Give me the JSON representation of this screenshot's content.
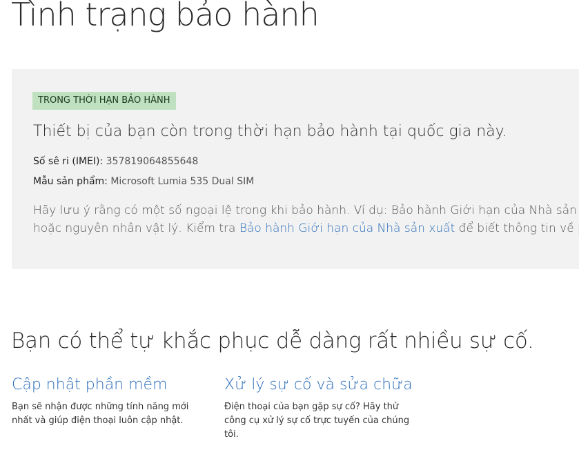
{
  "page": {
    "title": "Tình trạng bảo hành"
  },
  "status": {
    "badge": "TRONG THỜI HẠN BẢO HÀNH",
    "message": "Thiết bị của bạn còn trong thời hạn bảo hành tại quốc gia này.",
    "imei_label": "Số sê ri (IMEI):",
    "imei_value": "357819064855648",
    "model_label": "Mẫu sản phẩm:",
    "model_value": "Microsoft Lumia 535 Dual SIM",
    "note_line1": "Hãy lưu ý rằng có một số ngoại lệ trong khi bảo hành. Ví dụ: Bảo hành Giới hạn của Nhà sản xu",
    "note_line2_before": "hoặc nguyên nhân vật lý. Kiểm tra ",
    "note_link": "Bảo hành Giới hạn của Nhà sản xuất",
    "note_line2_after": " để biết thông tin về phạ",
    "badge_color": "#bfe1bf",
    "panel_color": "#f2f2f2",
    "link_color": "#2b6cb8"
  },
  "selfhelp": {
    "title": "Bạn có thể tự khắc phục dễ dàng rất nhiều sự cố.",
    "cards": [
      {
        "title": "Cập nhật phần mềm",
        "desc": "Bạn sẽ nhận được những tính năng mới nhất và giúp điện thoại luôn cập nhật."
      },
      {
        "title": "Xử lý sự cố và sửa chữa",
        "desc": "Điện thoại của bạn gặp sự cố? Hãy thử công cụ xử lý sự cố trực tuyến của chúng tôi."
      }
    ]
  }
}
